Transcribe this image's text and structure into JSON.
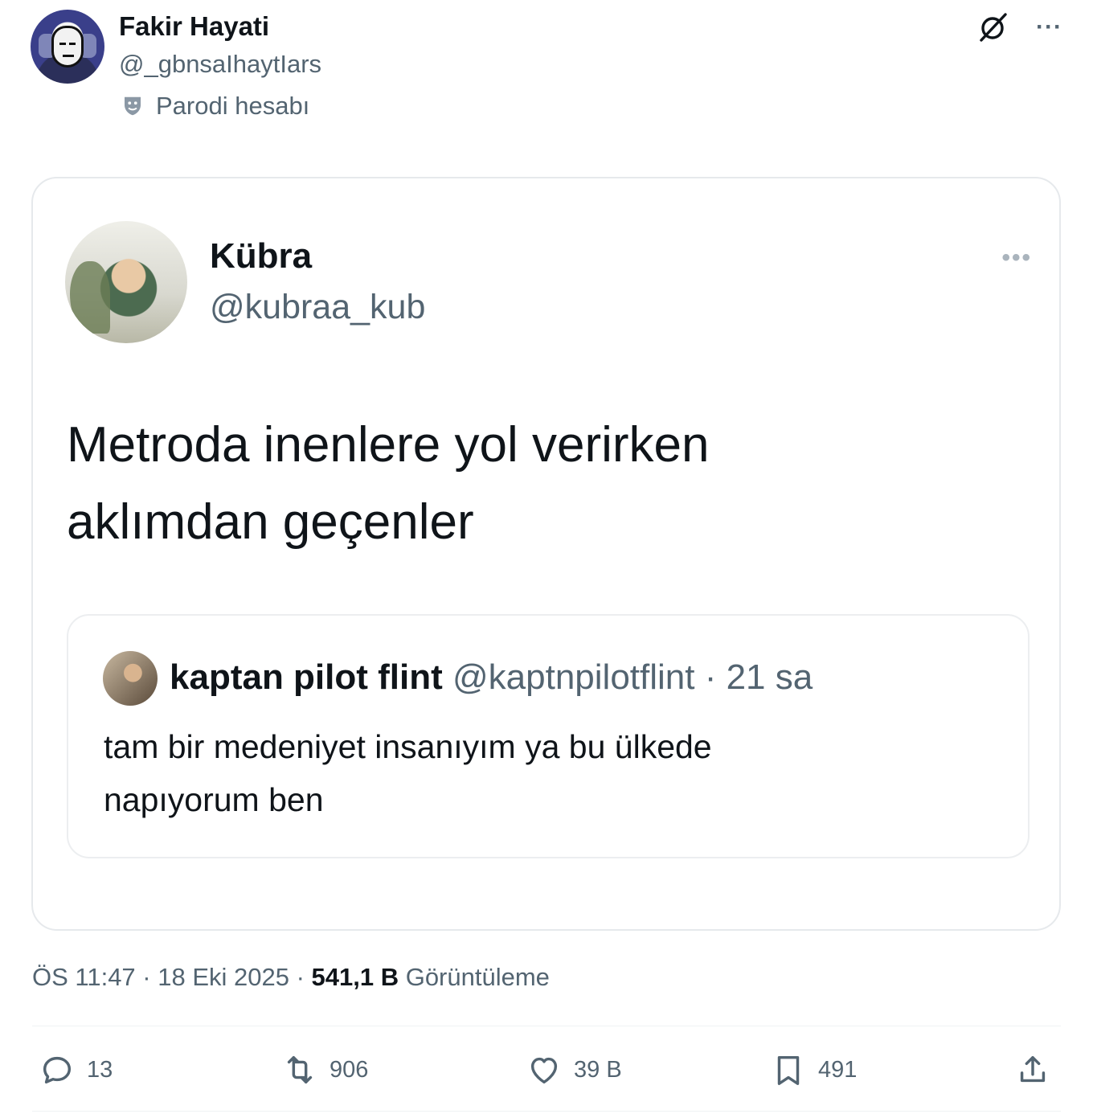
{
  "author": {
    "name": "Fakir Hayati",
    "handle": "@_gbnsaIhaytIars",
    "label": "Parodi hesabı"
  },
  "header_icons": [
    "grok-icon",
    "more-icon"
  ],
  "more_glyph": "···",
  "quoted_tweet": {
    "name": "Kübra",
    "handle": "@kubraa_kub",
    "more_glyph": "•••",
    "text_line1": "Metroda inenlere yol verirken",
    "text_line2": "aklımdan geçenler",
    "inner_quote": {
      "name": "kaptan pilot flint",
      "meta": " @kaptnpilotflint · 21 sa",
      "text_line1": "tam bir medeniyet insanıyım ya bu ülkede",
      "text_line2": "napıyorum ben"
    }
  },
  "timestamp": {
    "time": "ÖS 11:47 · 18 Eki 2025 · ",
    "views_count": "541,1 B",
    "views_label": " Görüntüleme"
  },
  "actions": {
    "replies": "13",
    "retweets": "906",
    "likes": "39 B",
    "bookmarks": "491"
  },
  "colors": {
    "text_primary": "#0f1419",
    "text_secondary": "#536471",
    "border": "#e6e9ec"
  }
}
